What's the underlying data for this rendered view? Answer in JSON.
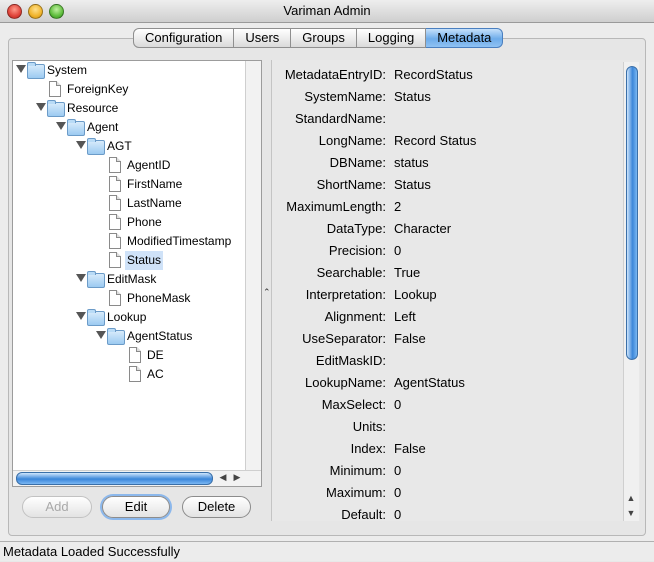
{
  "window": {
    "title": "Variman Admin"
  },
  "tabs": [
    {
      "label": "Configuration",
      "active": false
    },
    {
      "label": "Users",
      "active": false
    },
    {
      "label": "Groups",
      "active": false
    },
    {
      "label": "Logging",
      "active": false
    },
    {
      "label": "Metadata",
      "active": true
    }
  ],
  "tree": {
    "nodes": [
      {
        "label": "System",
        "type": "folder",
        "expanded": true,
        "depth": 0
      },
      {
        "label": "ForeignKey",
        "type": "leaf",
        "depth": 1
      },
      {
        "label": "Resource",
        "type": "folder",
        "expanded": true,
        "depth": 1
      },
      {
        "label": "Agent",
        "type": "folder",
        "expanded": true,
        "depth": 2
      },
      {
        "label": "AGT",
        "type": "folder",
        "expanded": true,
        "depth": 3
      },
      {
        "label": "AgentID",
        "type": "leaf",
        "depth": 4
      },
      {
        "label": "FirstName",
        "type": "leaf",
        "depth": 4
      },
      {
        "label": "LastName",
        "type": "leaf",
        "depth": 4
      },
      {
        "label": "Phone",
        "type": "leaf",
        "depth": 4
      },
      {
        "label": "ModifiedTimestamp",
        "type": "leaf",
        "depth": 4
      },
      {
        "label": "Status",
        "type": "leaf",
        "depth": 4,
        "selected": true
      },
      {
        "label": "EditMask",
        "type": "folder",
        "expanded": true,
        "depth": 3
      },
      {
        "label": "PhoneMask",
        "type": "leaf",
        "depth": 4
      },
      {
        "label": "Lookup",
        "type": "folder",
        "expanded": true,
        "depth": 3
      },
      {
        "label": "AgentStatus",
        "type": "folder",
        "expanded": true,
        "depth": 4
      },
      {
        "label": "DE",
        "type": "leaf",
        "depth": 5
      },
      {
        "label": "AC",
        "type": "leaf",
        "depth": 5
      }
    ]
  },
  "buttons": {
    "add": {
      "label": "Add",
      "enabled": false
    },
    "edit": {
      "label": "Edit",
      "enabled": true
    },
    "delete": {
      "label": "Delete",
      "enabled": true
    }
  },
  "details": [
    {
      "key": "MetadataEntryID:",
      "value": "RecordStatus"
    },
    {
      "key": "SystemName:",
      "value": "Status"
    },
    {
      "key": "StandardName:",
      "value": ""
    },
    {
      "key": "LongName:",
      "value": "Record Status"
    },
    {
      "key": "DBName:",
      "value": "status"
    },
    {
      "key": "ShortName:",
      "value": "Status"
    },
    {
      "key": "MaximumLength:",
      "value": "2"
    },
    {
      "key": "DataType:",
      "value": "Character"
    },
    {
      "key": "Precision:",
      "value": "0"
    },
    {
      "key": "Searchable:",
      "value": "True"
    },
    {
      "key": "Interpretation:",
      "value": "Lookup"
    },
    {
      "key": "Alignment:",
      "value": "Left"
    },
    {
      "key": "UseSeparator:",
      "value": "False"
    },
    {
      "key": "EditMaskID:",
      "value": ""
    },
    {
      "key": "LookupName:",
      "value": "AgentStatus"
    },
    {
      "key": "MaxSelect:",
      "value": "0"
    },
    {
      "key": "Units:",
      "value": ""
    },
    {
      "key": "Index:",
      "value": "False"
    },
    {
      "key": "Minimum:",
      "value": "0"
    },
    {
      "key": "Maximum:",
      "value": "0"
    },
    {
      "key": "Default:",
      "value": "0"
    }
  ],
  "icons": {
    "expanded": "triangle-down-icon",
    "folder": "folder-icon",
    "leaf": "document-icon",
    "splitter": "chevron-up-icon"
  },
  "status": {
    "text": "Metadata Loaded Successfully"
  }
}
